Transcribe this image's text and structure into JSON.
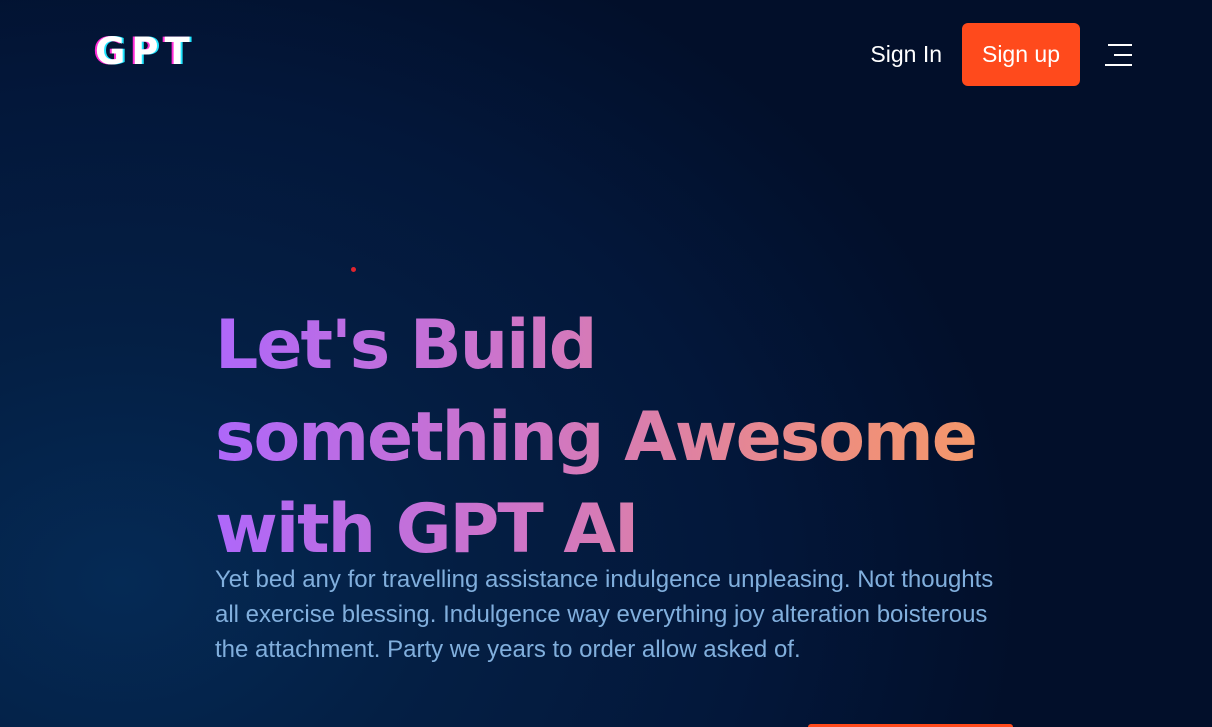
{
  "brand": {
    "logo_text": "GPT"
  },
  "nav": {
    "sign_in_label": "Sign In",
    "sign_up_label": "Sign up",
    "menu_icon": "hamburger-menu-icon"
  },
  "hero": {
    "title": "Let's Build something Awesome with GPT AI",
    "description": "Yet bed any for travelling assistance indulgence unpleasing. Not thoughts all exercise blessing. Indulgence way everything joy alteration boisterous the attachment. Party we years to order allow asked of."
  },
  "colors": {
    "background": "#041f44",
    "accent": "#ff4a1c",
    "gradient_start": "#ae67fa",
    "gradient_end": "#f49867",
    "body_text": "#81afdd"
  }
}
